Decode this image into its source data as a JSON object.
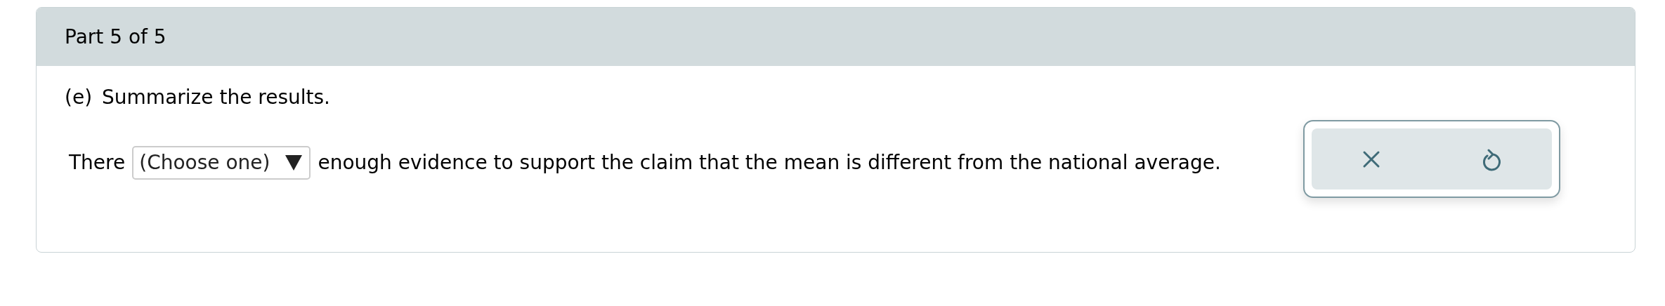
{
  "header": {
    "title": "Part 5 of 5"
  },
  "question": {
    "label": "(e)",
    "prompt": "Summarize the results."
  },
  "answer": {
    "prefix": "There",
    "dropdown": {
      "placeholder": "(Choose one)"
    },
    "suffix": "enough evidence to support the claim that the mean is different from the national average."
  }
}
